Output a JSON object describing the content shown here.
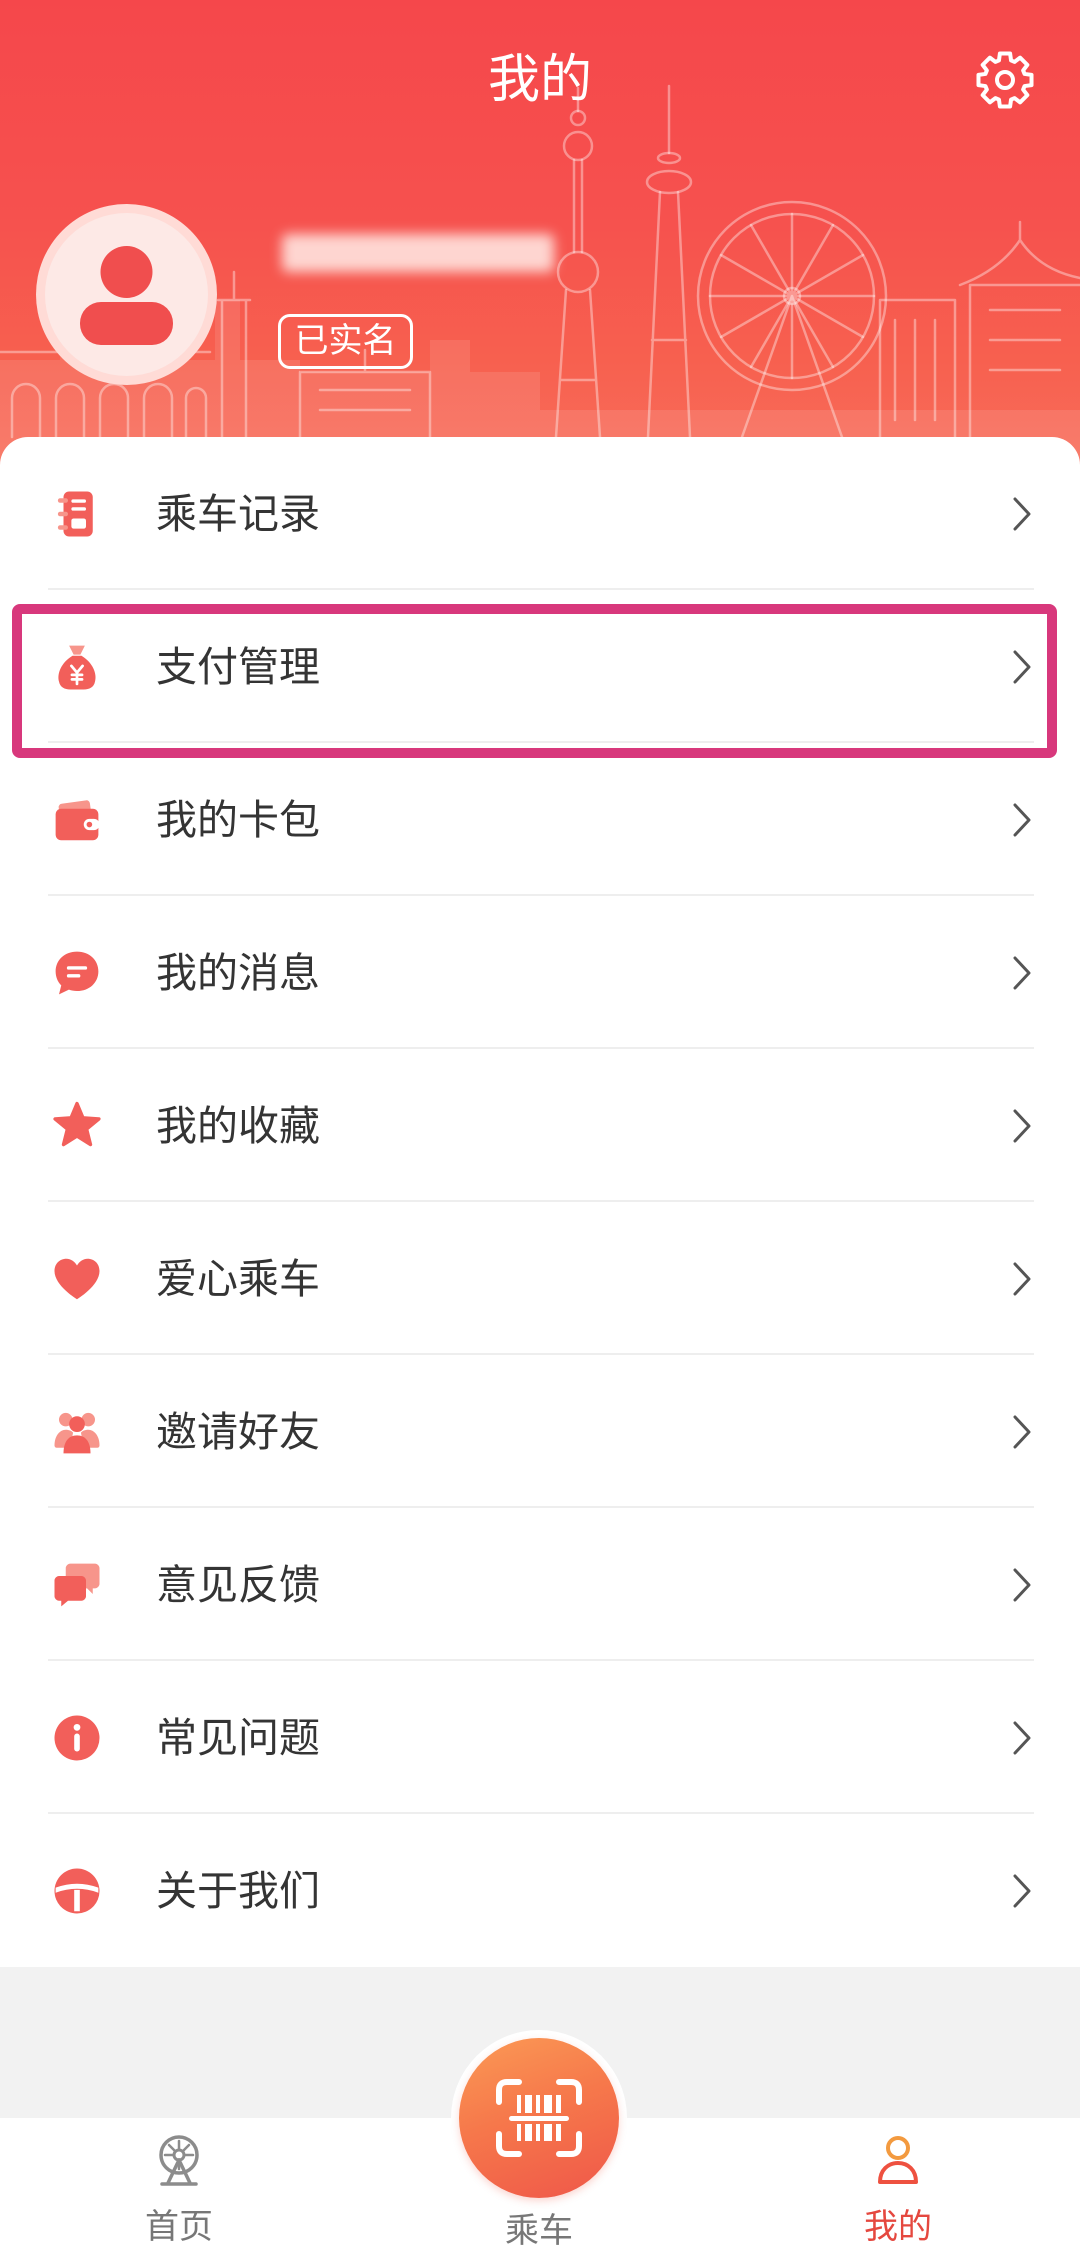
{
  "header": {
    "title": "我的",
    "settings_icon": "gear-icon"
  },
  "profile": {
    "avatar_icon": "user-avatar-icon",
    "verified_badge": "已实名"
  },
  "menu": {
    "items": [
      {
        "label": "乘车记录",
        "icon": "ride-record-icon"
      },
      {
        "label": "支付管理",
        "icon": "money-bag-icon"
      },
      {
        "label": "我的卡包",
        "icon": "wallet-icon"
      },
      {
        "label": "我的消息",
        "icon": "message-icon"
      },
      {
        "label": "我的收藏",
        "icon": "star-icon"
      },
      {
        "label": "爱心乘车",
        "icon": "heart-icon"
      },
      {
        "label": "邀请好友",
        "icon": "friends-icon"
      },
      {
        "label": "意见反馈",
        "icon": "feedback-icon"
      },
      {
        "label": "常见问题",
        "icon": "info-icon"
      },
      {
        "label": "关于我们",
        "icon": "about-icon"
      }
    ],
    "chevron_icon": "chevron-right-icon"
  },
  "highlight": {
    "item_index": 1,
    "border_color": "#d8387c"
  },
  "bottom_nav": {
    "items": [
      {
        "label": "首页",
        "icon": "ferris-wheel-icon",
        "active": false
      },
      {
        "label": "乘车",
        "icon": "scan-code-icon",
        "active": false
      },
      {
        "label": "我的",
        "icon": "user-icon",
        "active": true
      }
    ]
  },
  "colors": {
    "header_top": "#f5474b",
    "header_bottom": "#f86f5c",
    "icon_accent": "#f25f5a",
    "active_tab": "#e5483f",
    "inactive_tab": "#777777",
    "center_button": "#f6784b",
    "page_background": "#f2f2f2"
  }
}
